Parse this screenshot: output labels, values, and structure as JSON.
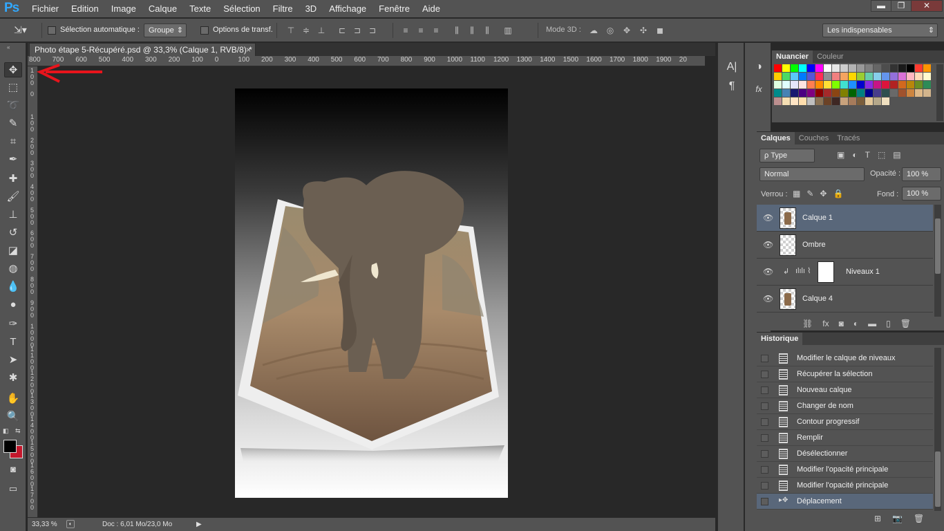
{
  "app": {
    "logo": "Ps"
  },
  "menu": [
    "Fichier",
    "Edition",
    "Image",
    "Calque",
    "Texte",
    "Sélection",
    "Filtre",
    "3D",
    "Affichage",
    "Fenêtre",
    "Aide"
  ],
  "window_buttons": {
    "minimize": "▬",
    "restore": "❐",
    "close": "✕"
  },
  "options_bar": {
    "auto_select_label": "Sélection automatique :",
    "auto_select_value": "Groupe",
    "transform_label": "Options de transf.",
    "mode3d_label": "Mode 3D :",
    "workspace_value": "Les indispensables"
  },
  "document": {
    "tab_title": "Photo étape 5-Récupéré.psd @ 33,3% (Calque 1, RVB/8) *",
    "close_glyph": "×"
  },
  "ruler_h": [
    "800",
    "700",
    "600",
    "500",
    "400",
    "300",
    "200",
    "100",
    "0",
    "100",
    "200",
    "300",
    "400",
    "500",
    "600",
    "700",
    "800",
    "900",
    "1000",
    "1100",
    "1200",
    "1300",
    "1400",
    "1500",
    "1600",
    "1700",
    "1800",
    "1900",
    "20"
  ],
  "ruler_v": [
    "1\n0\n0",
    "0",
    "1\n0\n0",
    "2\n0\n0",
    "3\n0\n0",
    "4\n0\n0",
    "5\n0\n0",
    "6\n0\n0",
    "7\n0\n0",
    "8\n0\n0",
    "9\n0\n0",
    "1\n0\n0\n0",
    "1\n1\n0\n0",
    "1\n2\n0\n0",
    "1\n3\n0\n0",
    "1\n4\n0\n0",
    "1\n5\n0\n0",
    "1\n6\n0\n0",
    "1\n7\n0\n0"
  ],
  "status": {
    "zoom": "33,33 %",
    "doc": "Doc : 6,01 Mo/23,0 Mo",
    "arrow": "▶"
  },
  "swatches_panel": {
    "tabs": [
      "Nuancier",
      "Couleur"
    ],
    "colors": [
      "#ff0000",
      "#ffff00",
      "#00ff00",
      "#00ffff",
      "#0000ff",
      "#ff00ff",
      "#ffffff",
      "#e6e6e6",
      "#cccccc",
      "#b3b3b3",
      "#999999",
      "#808080",
      "#666666",
      "#4d4d4d",
      "#333333",
      "#1a1a1a",
      "#000000",
      "#ff3b30",
      "#ff9500",
      "#ffcc00",
      "#4cd964",
      "#5ac8fa",
      "#007aff",
      "#5856d6",
      "#ff2d55",
      "#8e8e93",
      "#f08080",
      "#f4a460",
      "#ffd700",
      "#9acd32",
      "#66cdaa",
      "#87ceeb",
      "#6495ed",
      "#9370db",
      "#da70d6",
      "#ffb6c1",
      "#ffdab9",
      "#fffacd",
      "#e0ffe0",
      "#e0ffff",
      "#e6e6fa",
      "#ffe4e1",
      "#ff7f50",
      "#ff8c00",
      "#ffe135",
      "#7fff00",
      "#40e0d0",
      "#1e90ff",
      "#0000cd",
      "#8a2be2",
      "#c71585",
      "#dc143c",
      "#b22222",
      "#d2691e",
      "#b8860b",
      "#6b8e23",
      "#2e8b57",
      "#008b8b",
      "#4682b4",
      "#191970",
      "#4b0082",
      "#800080",
      "#8b0000",
      "#a52a2a",
      "#8b4513",
      "#808000",
      "#006400",
      "#008080",
      "#00008b",
      "#483d8b",
      "#2f4f4f",
      "#696969",
      "#a0522d",
      "#cd853f",
      "#deb887",
      "#d2b48c",
      "#bc8f8f",
      "#f5deb3",
      "#ffe4c4",
      "#ffdead",
      "#c0c0c0",
      "#8b7355",
      "#6b4226",
      "#3e2723",
      "#c8a27c",
      "#a67b5b",
      "#7b5e3b",
      "#e5c99a",
      "#b5a88a",
      "#f0e0c0"
    ]
  },
  "layers_panel": {
    "tabs": [
      "Calques",
      "Couches",
      "Tracés"
    ],
    "filter_value": "ρ Type",
    "blend_mode": "Normal",
    "opacity_label": "Opacité :",
    "opacity_value": "100 %",
    "lock_label": "Verrou :",
    "fill_label": "Fond :",
    "fill_value": "100 %",
    "layers": [
      {
        "name": "Calque 1",
        "selected": true
      },
      {
        "name": "Ombre",
        "selected": false
      },
      {
        "name": "Niveaux 1",
        "selected": false
      },
      {
        "name": "Calque 4",
        "selected": false
      }
    ]
  },
  "history_panel": {
    "tab": "Historique",
    "items": [
      {
        "label": "Modifier le calque de niveaux",
        "selected": false
      },
      {
        "label": "Récupérer la sélection",
        "selected": false
      },
      {
        "label": "Nouveau calque",
        "selected": false
      },
      {
        "label": "Changer de nom",
        "selected": false
      },
      {
        "label": "Contour progressif",
        "selected": false
      },
      {
        "label": "Remplir",
        "selected": false
      },
      {
        "label": "Désélectionner",
        "selected": false
      },
      {
        "label": "Modifier l'opacité principale",
        "selected": false
      },
      {
        "label": "Modifier l'opacité principale",
        "selected": false
      },
      {
        "label": "Déplacement",
        "selected": true
      }
    ]
  }
}
